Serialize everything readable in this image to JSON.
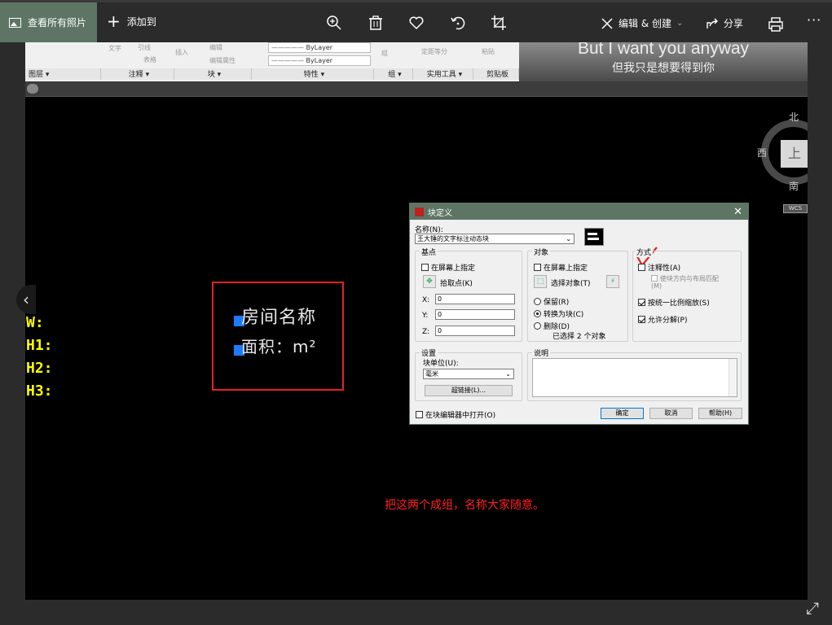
{
  "topbar": {
    "see_all": "查看所有照片",
    "add_to": "添加到",
    "edit_create": "编辑 & 创建",
    "share": "分享",
    "more": "···"
  },
  "ribbon": {
    "bylayer_1": "ByLayer",
    "bylayer_2": "ByLayer",
    "groups": [
      "图层 ▾",
      "注释 ▾",
      "块 ▾",
      "特性 ▾",
      "组 ▾",
      "实用工具 ▾",
      "剪贴板"
    ],
    "faint": [
      "文字",
      "引线",
      "表格",
      "插入",
      "编辑",
      "编辑属性",
      "组",
      "定距等分",
      "粘贴"
    ]
  },
  "lyrics": {
    "en": "But I want you anyway",
    "cn": "但我只是想要得到你"
  },
  "drawing": {
    "labels": [
      "W:",
      "H1:",
      "H2:",
      "H3:"
    ],
    "room_name": "房间名称",
    "room_area": "面积：m²",
    "note": "把这两个成组，名称大家随意。"
  },
  "compass": {
    "north": "北",
    "west": "西",
    "south": "南",
    "top": "上",
    "wcs": "WCS"
  },
  "dialog": {
    "title": "块定义",
    "name_label": "名称(N):",
    "name_value": "王大锤的文字标注动态块",
    "base": {
      "legend": "基点",
      "on_screen": "在屏幕上指定",
      "pick": "拾取点(K)",
      "x_label": "X:",
      "x": "0",
      "y_label": "Y:",
      "y": "0",
      "z_label": "Z:",
      "z": "0"
    },
    "objects": {
      "legend": "对象",
      "on_screen": "在屏幕上指定",
      "select": "选择对象(T)",
      "retain": "保留(R)",
      "convert": "转换为块(C)",
      "delete": "删除(D)",
      "selected": "已选择 2 个对象"
    },
    "behavior": {
      "legend": "方式",
      "annotative": "注释性(A)",
      "match": "使块方向与布局匹配(M)",
      "uniform": "按统一比例缩放(S)",
      "explode": "允许分解(P)"
    },
    "settings": {
      "legend": "设置",
      "unit_label": "块单位(U):",
      "unit_value": "毫米",
      "hyperlink": "超链接(L)..."
    },
    "description": {
      "legend": "说明"
    },
    "open_editor": "在块编辑器中打开(O)",
    "ok": "确定",
    "cancel": "取消",
    "help": "帮助(H)"
  },
  "colors": {
    "accent": "#5e7565",
    "annotation_red": "#e32222",
    "label_yellow": "#ffff00",
    "grip_blue": "#1e7bff"
  }
}
